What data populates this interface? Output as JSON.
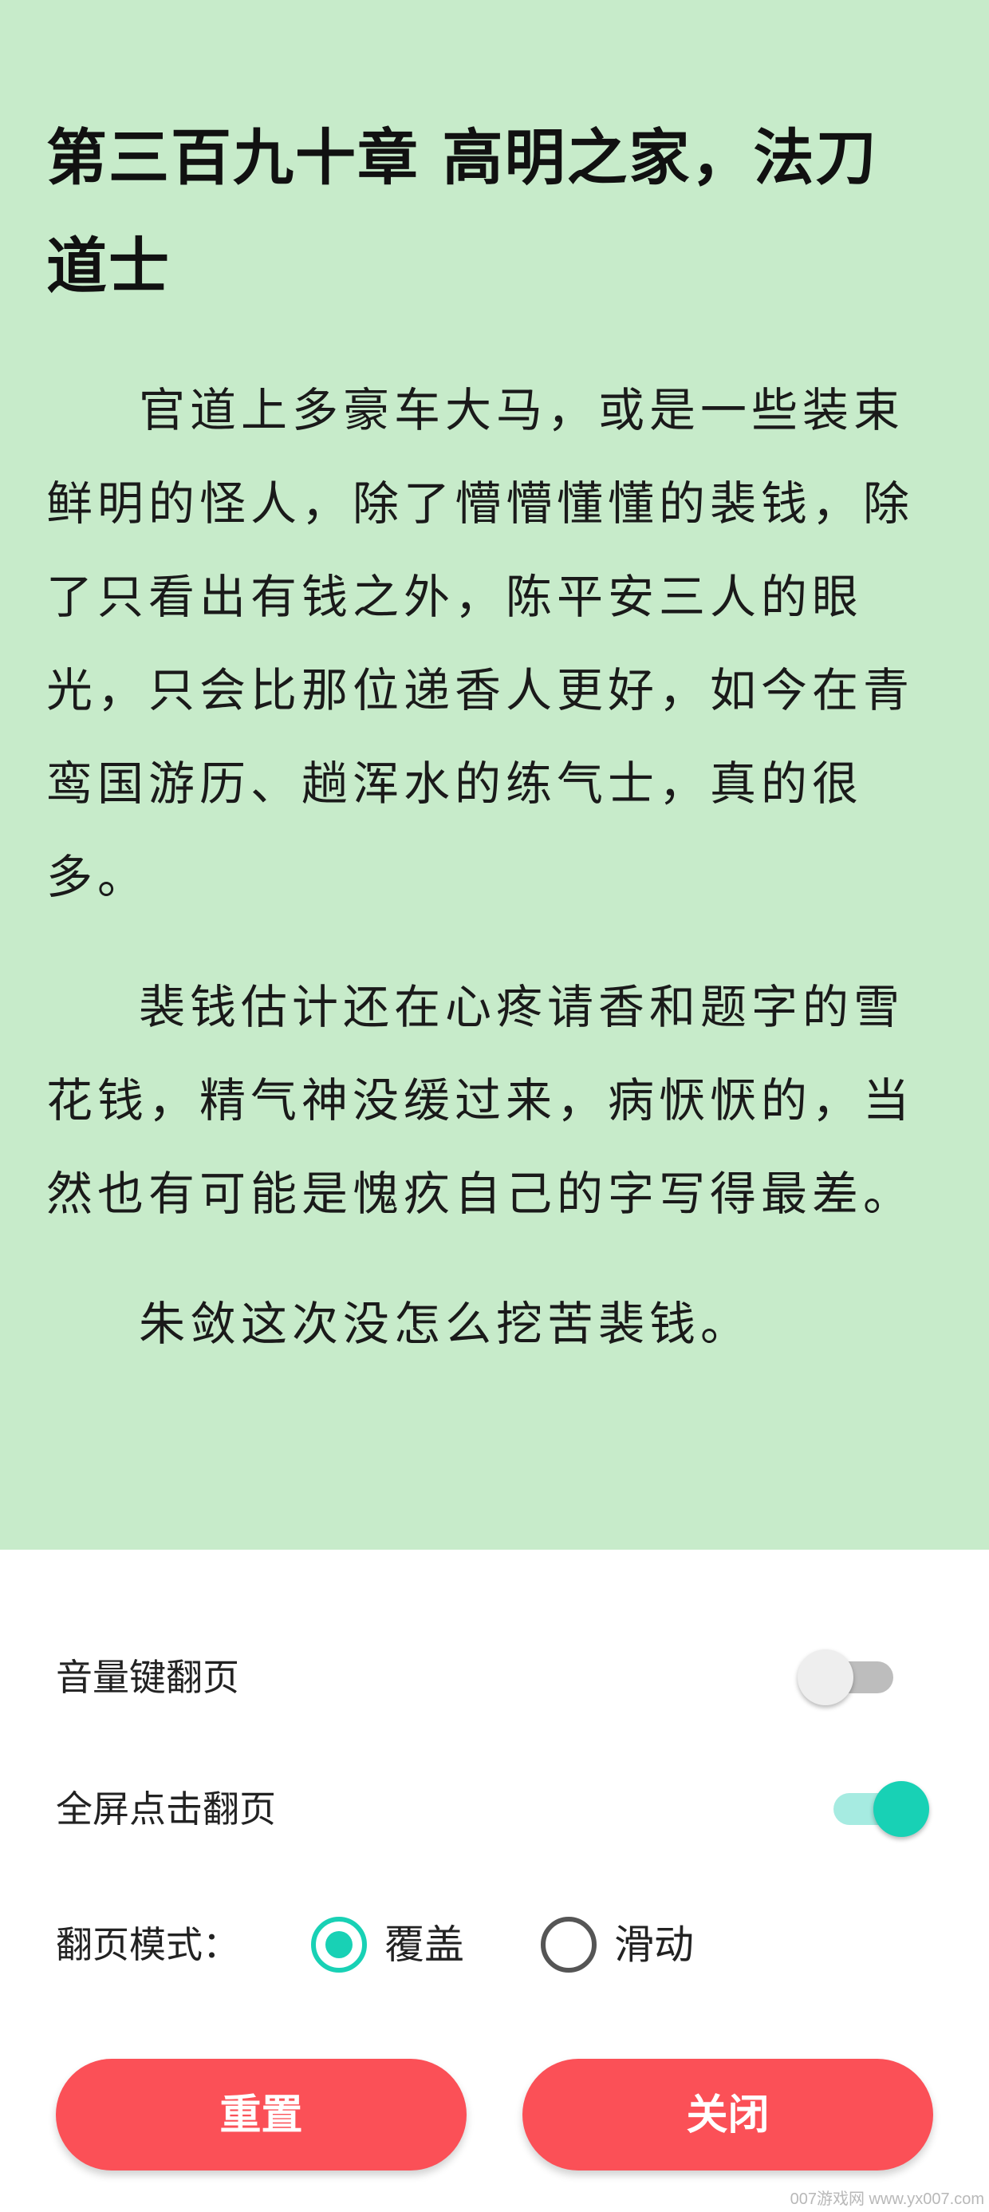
{
  "reader": {
    "chapter_title": "第三百九十章 高明之家，法刀道士",
    "paragraphs": [
      "官道上多豪车大马，或是一些装束鲜明的怪人，除了懵懵懂懂的裴钱，除了只看出有钱之外，陈平安三人的眼光，只会比那位递香人更好，如今在青鸾国游历、趟浑水的练气士，真的很多。",
      "裴钱估计还在心疼请香和题字的雪花钱，精气神没缓过来，病恹恹的，当然也有可能是愧疚自己的字写得最差。",
      "朱敛这次没怎么挖苦裴钱。"
    ],
    "background_color": "#c7ebca"
  },
  "settings": {
    "volume_key_flip": {
      "label": "音量键翻页",
      "enabled": false
    },
    "fullscreen_tap_flip": {
      "label": "全屏点击翻页",
      "enabled": true
    },
    "flip_mode": {
      "label": "翻页模式：",
      "options": [
        {
          "label": "覆盖",
          "selected": true
        },
        {
          "label": "滑动",
          "selected": false
        }
      ]
    }
  },
  "buttons": {
    "reset_label": "重置",
    "close_label": "关闭"
  },
  "watermark": "007游戏网 www.yx007.com",
  "colors": {
    "accent": "#18d1b5",
    "button": "#fb5057"
  }
}
